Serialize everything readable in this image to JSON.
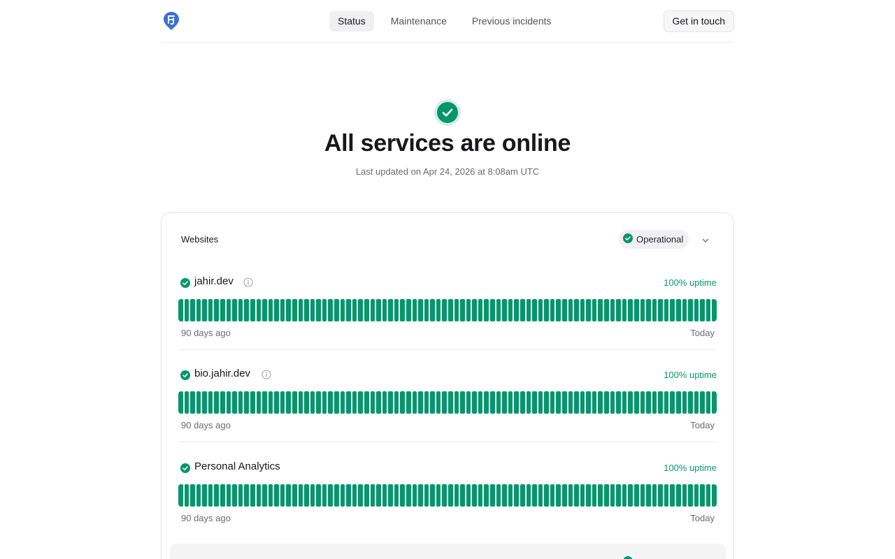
{
  "nav": {
    "items": [
      {
        "label": "Status",
        "active": true
      },
      {
        "label": "Maintenance",
        "active": false
      },
      {
        "label": "Previous incidents",
        "active": false
      }
    ],
    "cta_label": "Get in touch"
  },
  "hero": {
    "icon": "check-circle-icon",
    "title": "All services are online",
    "subtitle": "Last updated on Apr 24, 2026 at 8:08am UTC"
  },
  "groups": [
    {
      "title": "Websites",
      "status": "Operational",
      "services": [
        {
          "name": "jahir.dev",
          "uptime": "100% uptime",
          "has_info": true,
          "range_start": "90 days ago",
          "range_end": "Today",
          "day_count": 90,
          "days_up": 90
        },
        {
          "name": "bio.jahir.dev",
          "uptime": "100% uptime",
          "has_info": true,
          "range_start": "90 days ago",
          "range_end": "Today",
          "day_count": 90,
          "days_up": 90
        },
        {
          "name": "Personal Analytics",
          "uptime": "100% uptime",
          "has_info": false,
          "range_start": "90 days ago",
          "range_end": "Today",
          "day_count": 90,
          "days_up": 90
        }
      ]
    }
  ],
  "colors": {
    "operational": "#059669",
    "operational_soft": "#d7ede4",
    "logo": "#3b6fd8"
  }
}
